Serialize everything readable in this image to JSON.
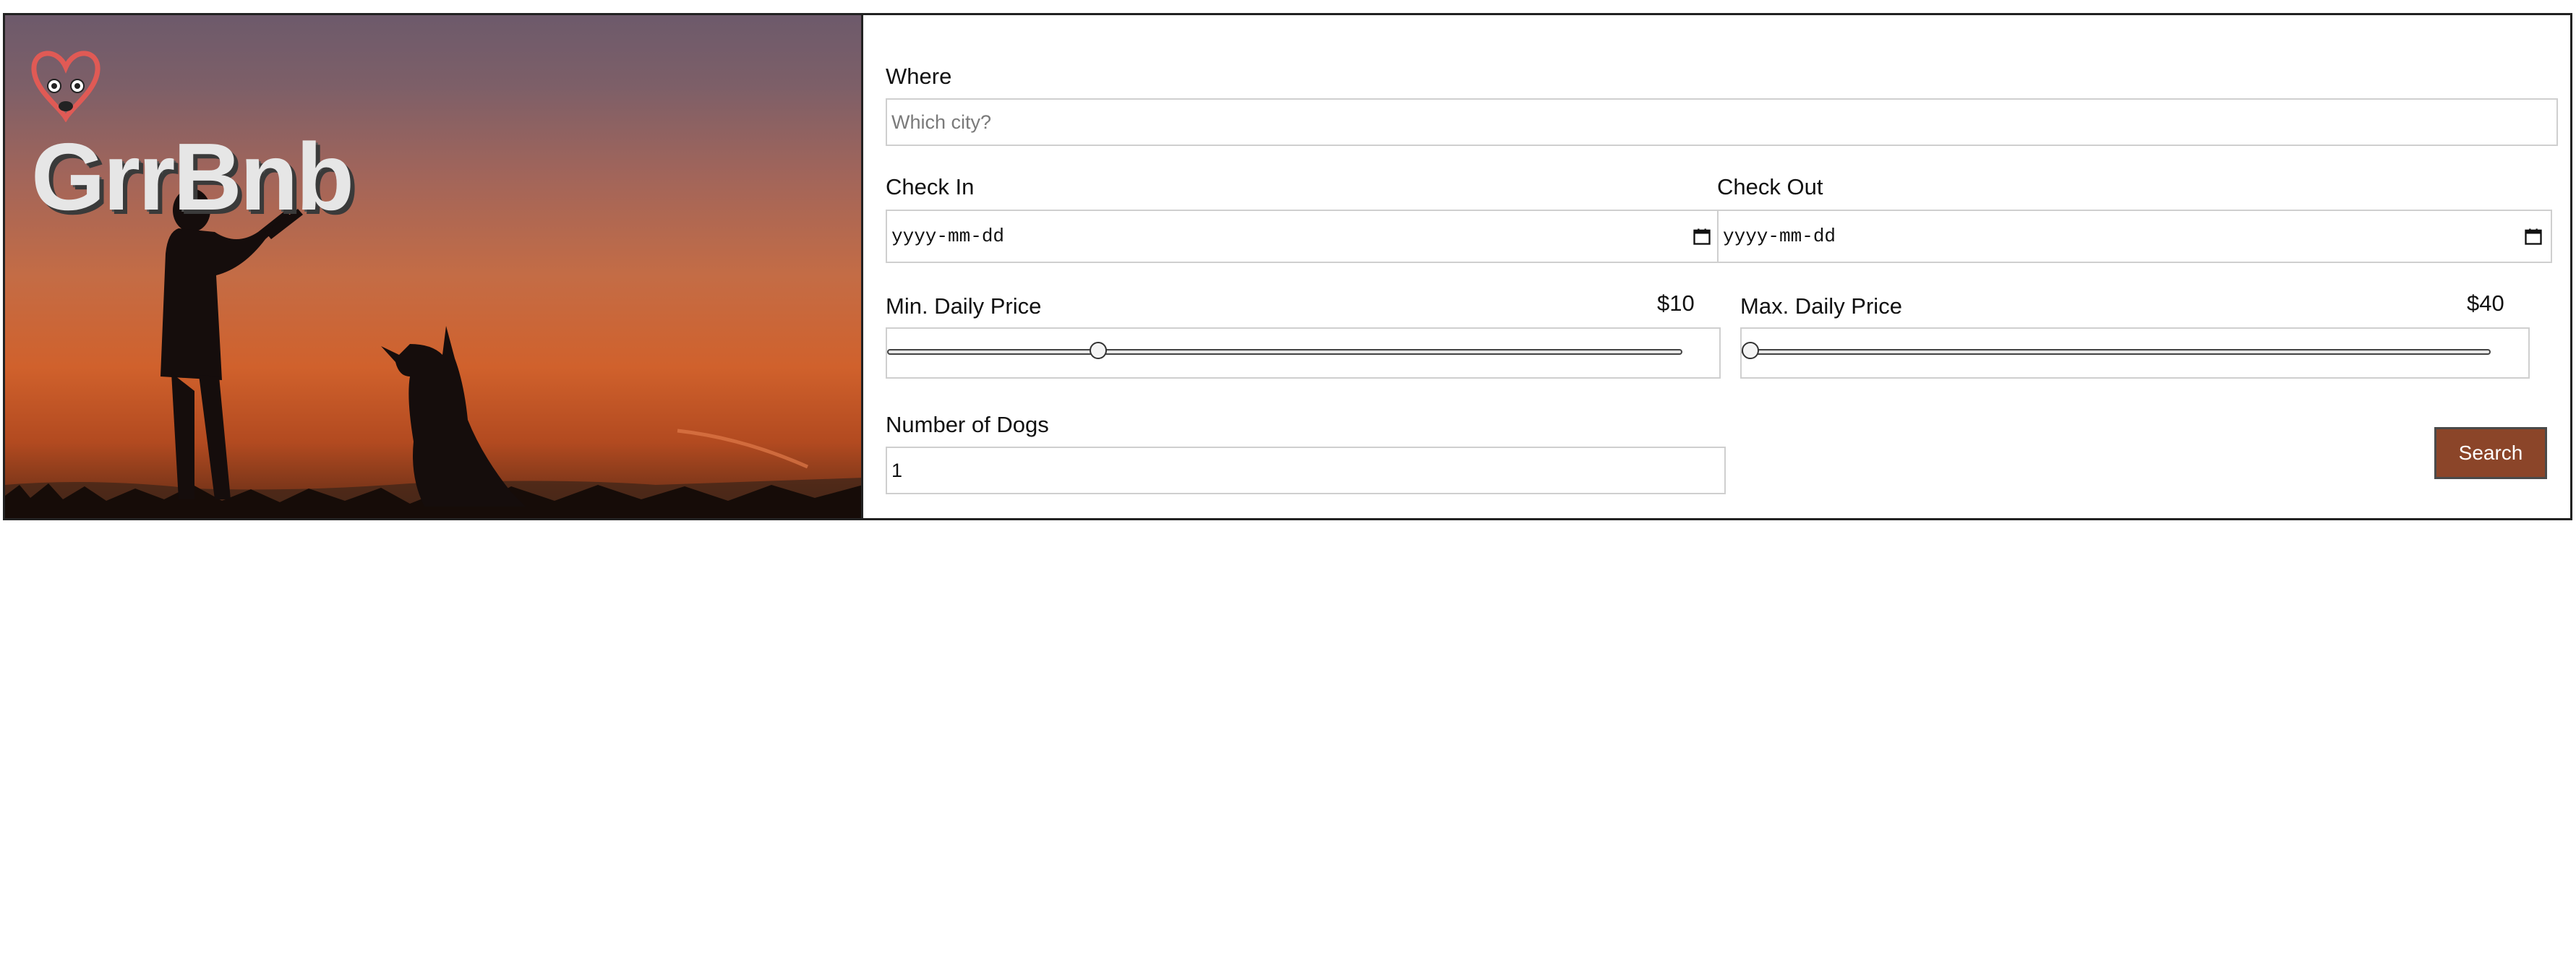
{
  "brand": {
    "name": "GrrBnb",
    "logo_icon": "dog-heart-logo-icon"
  },
  "form": {
    "where": {
      "label": "Where",
      "placeholder": "Which city?",
      "value": ""
    },
    "check_in": {
      "label": "Check In",
      "placeholder": "yyyy-mm-dd",
      "icon": "calendar-icon"
    },
    "check_out": {
      "label": "Check Out",
      "placeholder": "yyyy-mm-dd",
      "icon": "calendar-icon"
    },
    "min_price": {
      "label": "Min. Daily Price",
      "display": "$10",
      "fraction": 0.26
    },
    "max_price": {
      "label": "Max. Daily Price",
      "display": "$40",
      "fraction": 0.0
    },
    "dogs": {
      "label": "Number of Dogs",
      "value": "1"
    },
    "search_label": "Search"
  },
  "colors": {
    "accent": "#8b4529",
    "logo": "#e05a55",
    "sunset_top": "#6d5a6b",
    "sunset_bottom": "#d0612c"
  }
}
